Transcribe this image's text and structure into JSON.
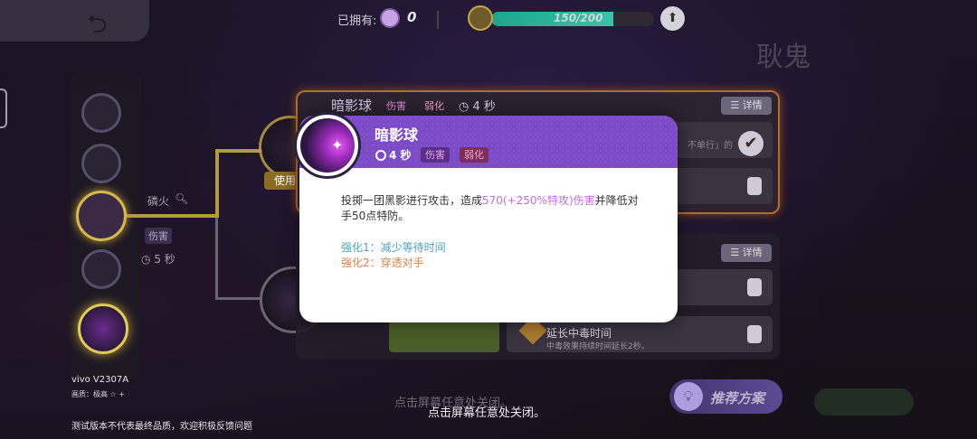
{
  "topbar": {
    "owned_label": "已拥有:",
    "owned_count": "0",
    "xp_text": "150/200",
    "xp_progress": 0.75,
    "pokemon_name": "耿鬼"
  },
  "skill_tree": {
    "side_label": "磷火",
    "damage_tag": "伤害",
    "cooldown": "5 秒",
    "use_badge": "使用"
  },
  "background_panel": {
    "skill_name": "暗影球",
    "tag_damage": "伤害",
    "tag_weaken": "弱化",
    "cooldown": "4 秒",
    "detail_button": "详情",
    "detail_button_2": "详情",
    "quote": "不单行」的",
    "row_title": "延长中毒时间",
    "row_sub": "中毒效果持续时间延长2秒。"
  },
  "modal": {
    "title": "暗影球",
    "cooldown": "4 秒",
    "tag_damage": "伤害",
    "tag_weaken": "弱化",
    "desc_part1": "投掷一团黑影进行攻击，造成",
    "desc_highlight": "570(+250%特攻)伤害",
    "desc_part2": "并降低对手50点特防。",
    "enhancement1": "强化1：减少等待时间",
    "enhancement2": "强化2：穿透对手"
  },
  "recommend_button": "推荐方案",
  "close_hint": "点击屏幕任意处关闭。",
  "close_hint_ghost": "点击屏幕任意处关闭。",
  "watermark": {
    "device_model": "vivo V2307A",
    "quality": "画质：极高 ☆ +",
    "notice": "测试版本不代表最终品质，欢迎积极反馈问题"
  },
  "colors": {
    "modal_header": "#7c4bc8",
    "highlight": "#c86ae0",
    "enhancement1": "#4aa3c4",
    "enhancement2": "#e0804a",
    "tree_gold": "#d7b948"
  },
  "icons": {
    "back": "back-arrow-icon",
    "currency": "candy-icon",
    "level": "level-badge-icon",
    "upgrade": "upgrade-arrow-icon",
    "timer": "clock-icon",
    "lock": "lock-icon",
    "check": "check-icon",
    "recommend": "lightbulb-icon",
    "skill": "shadow-ball-icon"
  }
}
